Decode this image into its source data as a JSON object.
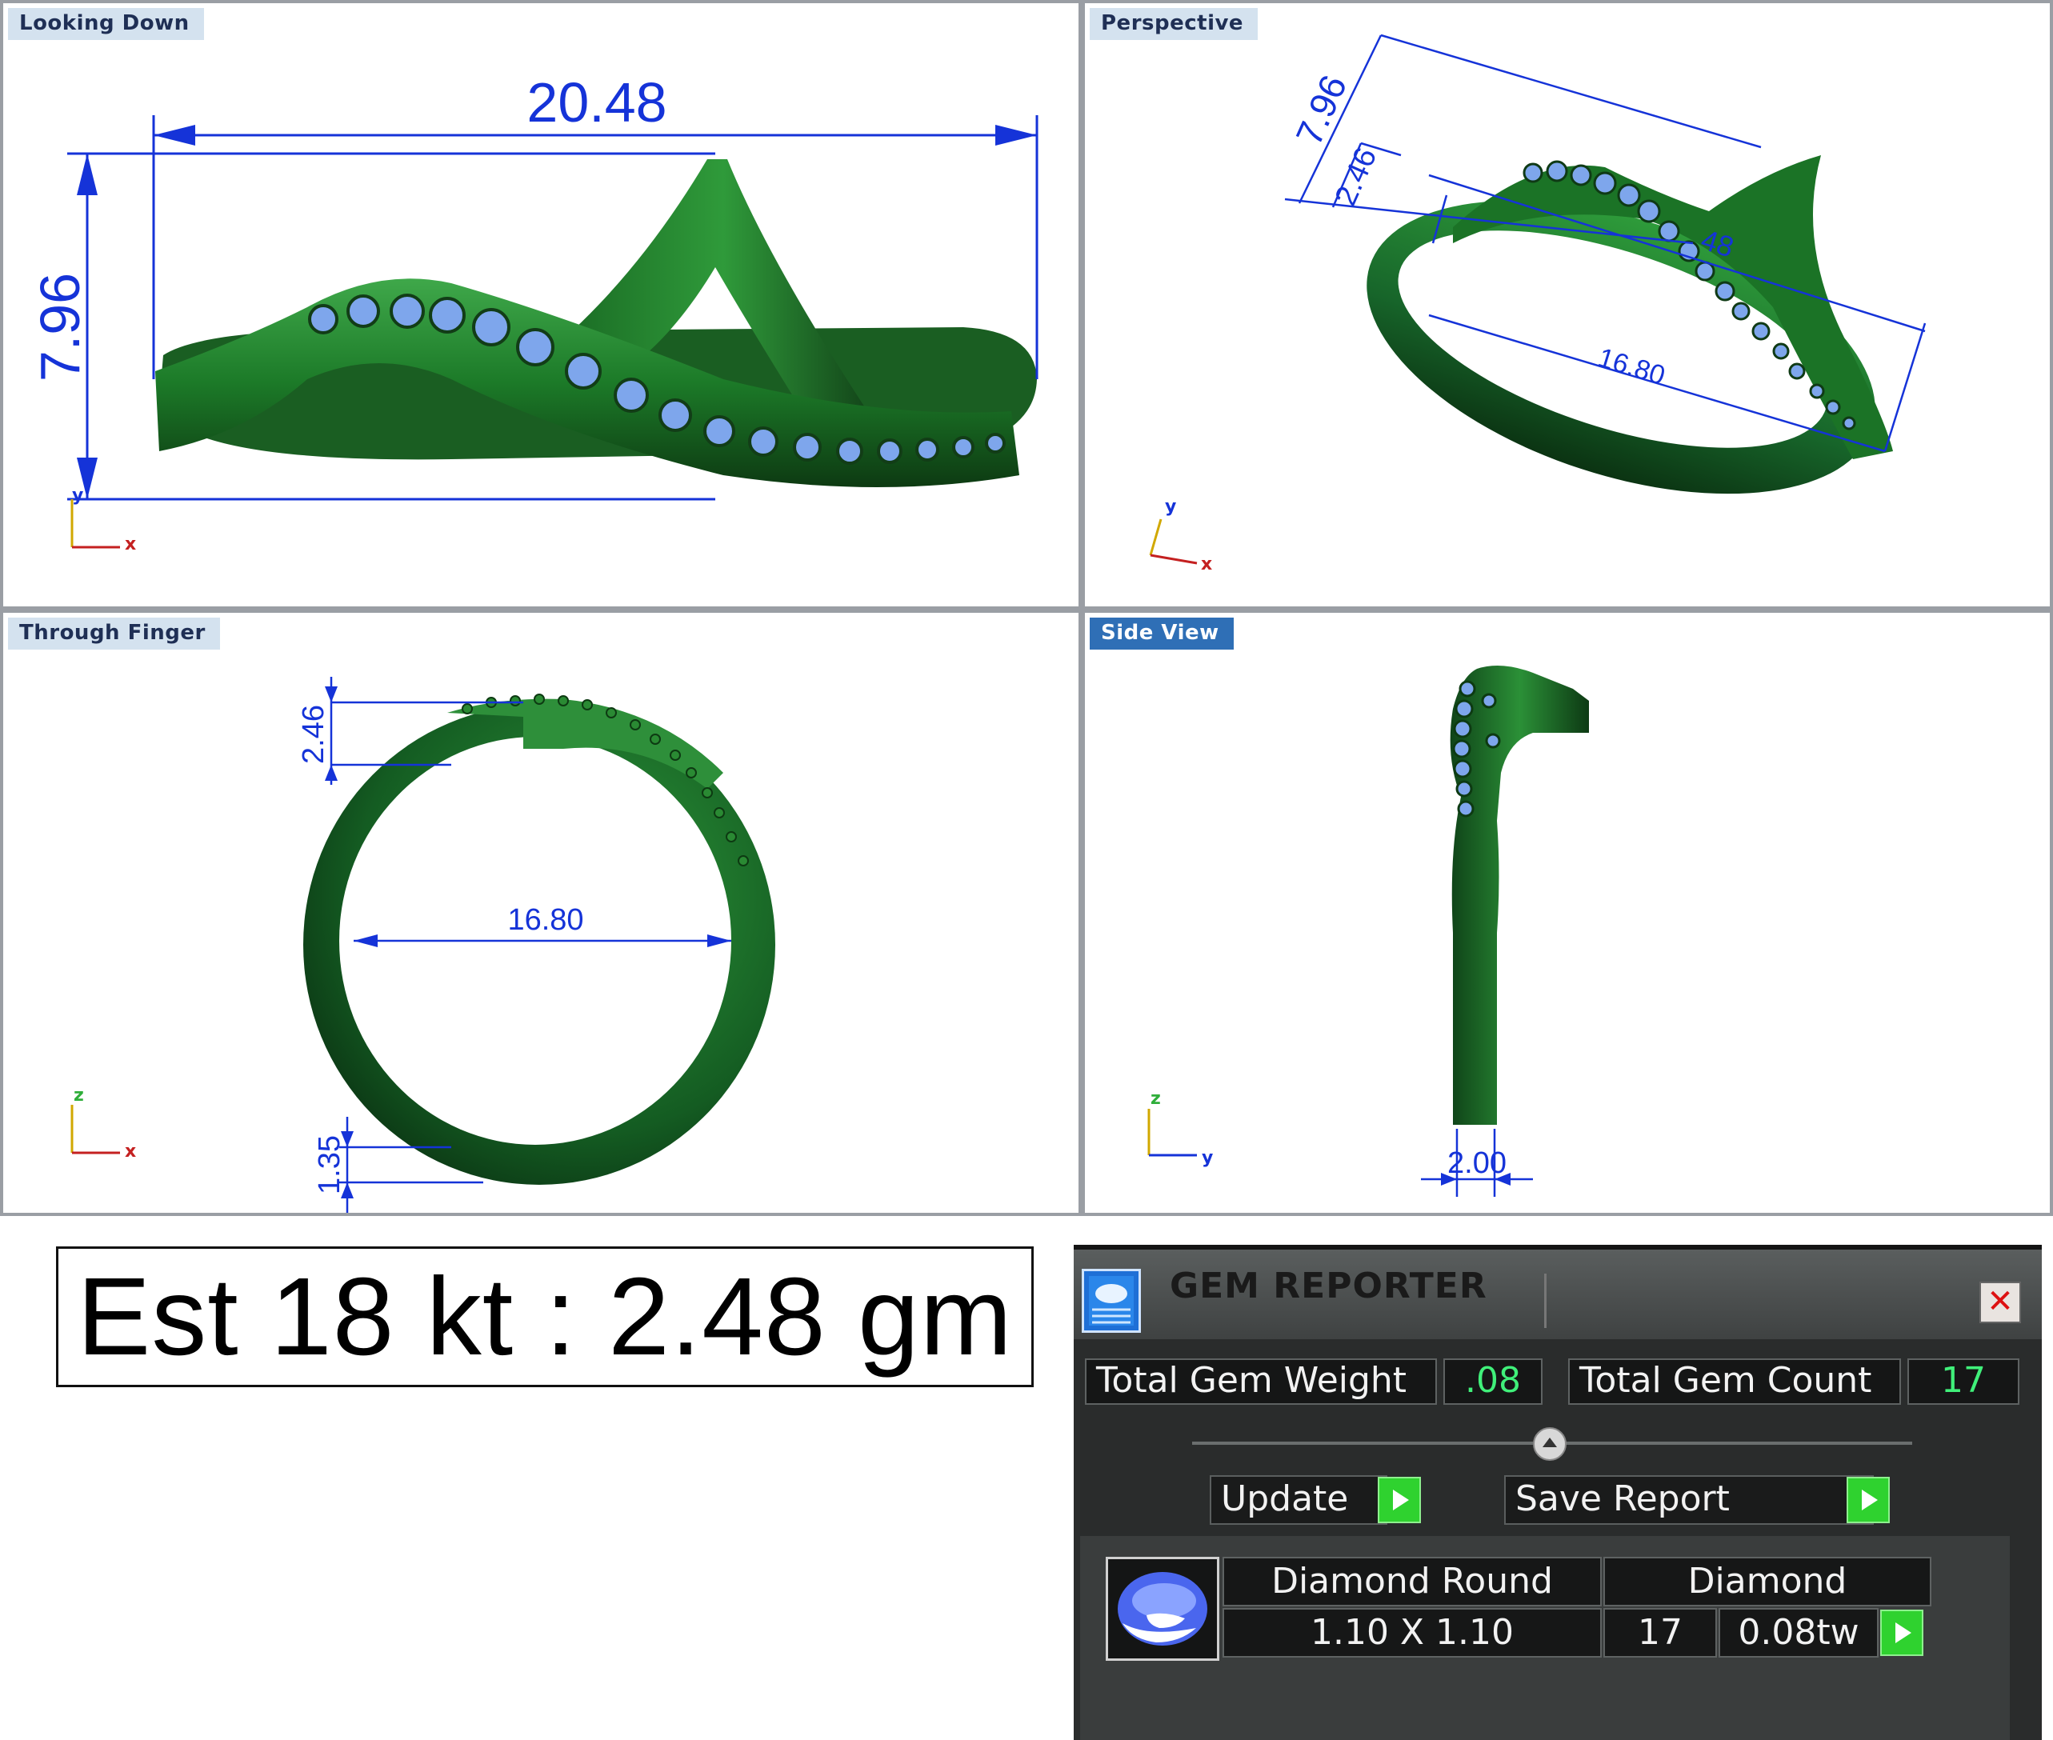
{
  "viewports": {
    "top": {
      "label": "Looking Down",
      "dim_width": "20.48",
      "dim_height": "7.96",
      "axis_h": "x",
      "axis_v": "y"
    },
    "perspective": {
      "label": "Perspective",
      "dim_height": "7.96",
      "dim_band": "2.46",
      "dim_inner": "16.80",
      "dim_partial": "48",
      "axis_h": "x",
      "axis_v": "y"
    },
    "front": {
      "label": "Through Finger",
      "dim_top": "2.46",
      "dim_inner": "16.80",
      "dim_bottom": "1.35",
      "axis_h": "x",
      "axis_v": "z"
    },
    "side": {
      "label": "Side View",
      "dim_width": "2.00",
      "axis_h": "y",
      "axis_v": "z"
    }
  },
  "weight_estimate": "Est 18 kt : 2.48 gm",
  "gem_reporter": {
    "title": "GEM REPORTER",
    "close_symbol": "✕",
    "total_weight_label": "Total Gem Weight",
    "total_weight_value": ".08",
    "total_count_label": "Total Gem Count",
    "total_count_value": "17",
    "update_label": "Update",
    "save_label": "Save Report",
    "row": {
      "name": "Diamond Round",
      "size": "1.10 X 1.10",
      "material": "Diamond",
      "count": "17",
      "weight": "0.08tw"
    }
  },
  "colors": {
    "metal": "#1f7a2a",
    "gem": "#7ea6ec",
    "dimension": "#1533d8",
    "value_green": "#40f07a"
  }
}
